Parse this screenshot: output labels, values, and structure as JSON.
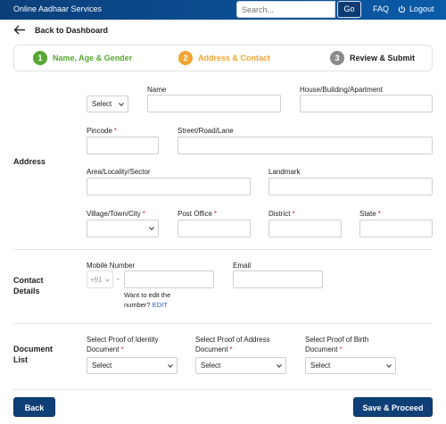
{
  "header": {
    "brand": "Online Aadhaar Services",
    "search_placeholder": "Search...",
    "go_label": "Go",
    "faq_label": "FAQ",
    "logout_label": "Logout"
  },
  "nav": {
    "back_to_dashboard": "Back to Dashboard"
  },
  "stepper": {
    "steps": [
      {
        "num": "1",
        "label": "Name, Age & Gender",
        "state": "completed",
        "color": "#57a832"
      },
      {
        "num": "2",
        "label": "Address & Contact",
        "state": "current",
        "color": "#f0a533"
      },
      {
        "num": "3",
        "label": "Review & Submit",
        "state": "pending",
        "color": "#8a8a8a"
      }
    ]
  },
  "address": {
    "section_title": "Address",
    "care_of_select": "Select",
    "name_label": "Name",
    "house_label": "House/Building/Apartment",
    "pincode_label": "Pincode",
    "street_label": "Street/Road/Lane",
    "area_label": "Area/Locality/Sector",
    "landmark_label": "Landmark",
    "village_label": "Village/Town/City",
    "post_office_label": "Post Office",
    "district_label": "District",
    "state_label": "State",
    "required_mark": "*"
  },
  "contact": {
    "section_title_line1": "Contact",
    "section_title_line2": "Details",
    "mobile_label": "Mobile Number",
    "country_code": "+91",
    "separator": "-",
    "email_label": "Email",
    "edit_note_line1": "Want to edit the",
    "edit_note_line2": "number?",
    "edit_link": "EDIT"
  },
  "documents": {
    "section_title_line1": "Document",
    "section_title_line2": "List",
    "identity_label_line1": "Select Proof of Identity",
    "identity_label_line2": "Document",
    "address_label_line1": "Select Proof of Address",
    "address_label_line2": "Document",
    "birth_label_line1": "Select Proof of Birth",
    "birth_label_line2": "Document",
    "select_value": "Select"
  },
  "footer": {
    "back_label": "Back",
    "save_label": "Save & Proceed"
  },
  "colors": {
    "header_dark": "#0b3f7a",
    "button": "#0f3f77",
    "required": "#d0262a",
    "link": "#1e63b8"
  }
}
